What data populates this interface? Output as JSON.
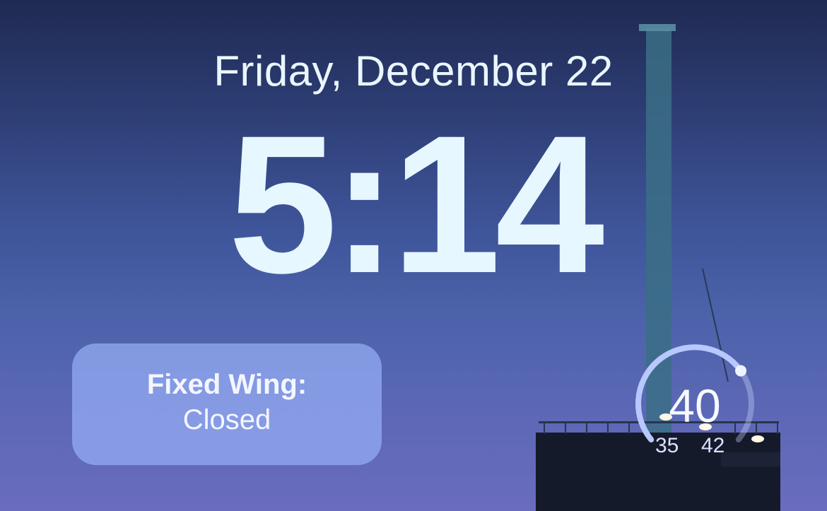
{
  "lock_screen": {
    "date": "Friday, December 22",
    "time": "5:14"
  },
  "widget": {
    "title": "Fixed Wing:",
    "status": "Closed"
  },
  "weather_gauge": {
    "current": "40",
    "low": "35",
    "high": "42",
    "level_fraction": 0.71
  },
  "colors": {
    "accent": "#e6f7ff",
    "widget_bg": "#96aff5"
  }
}
